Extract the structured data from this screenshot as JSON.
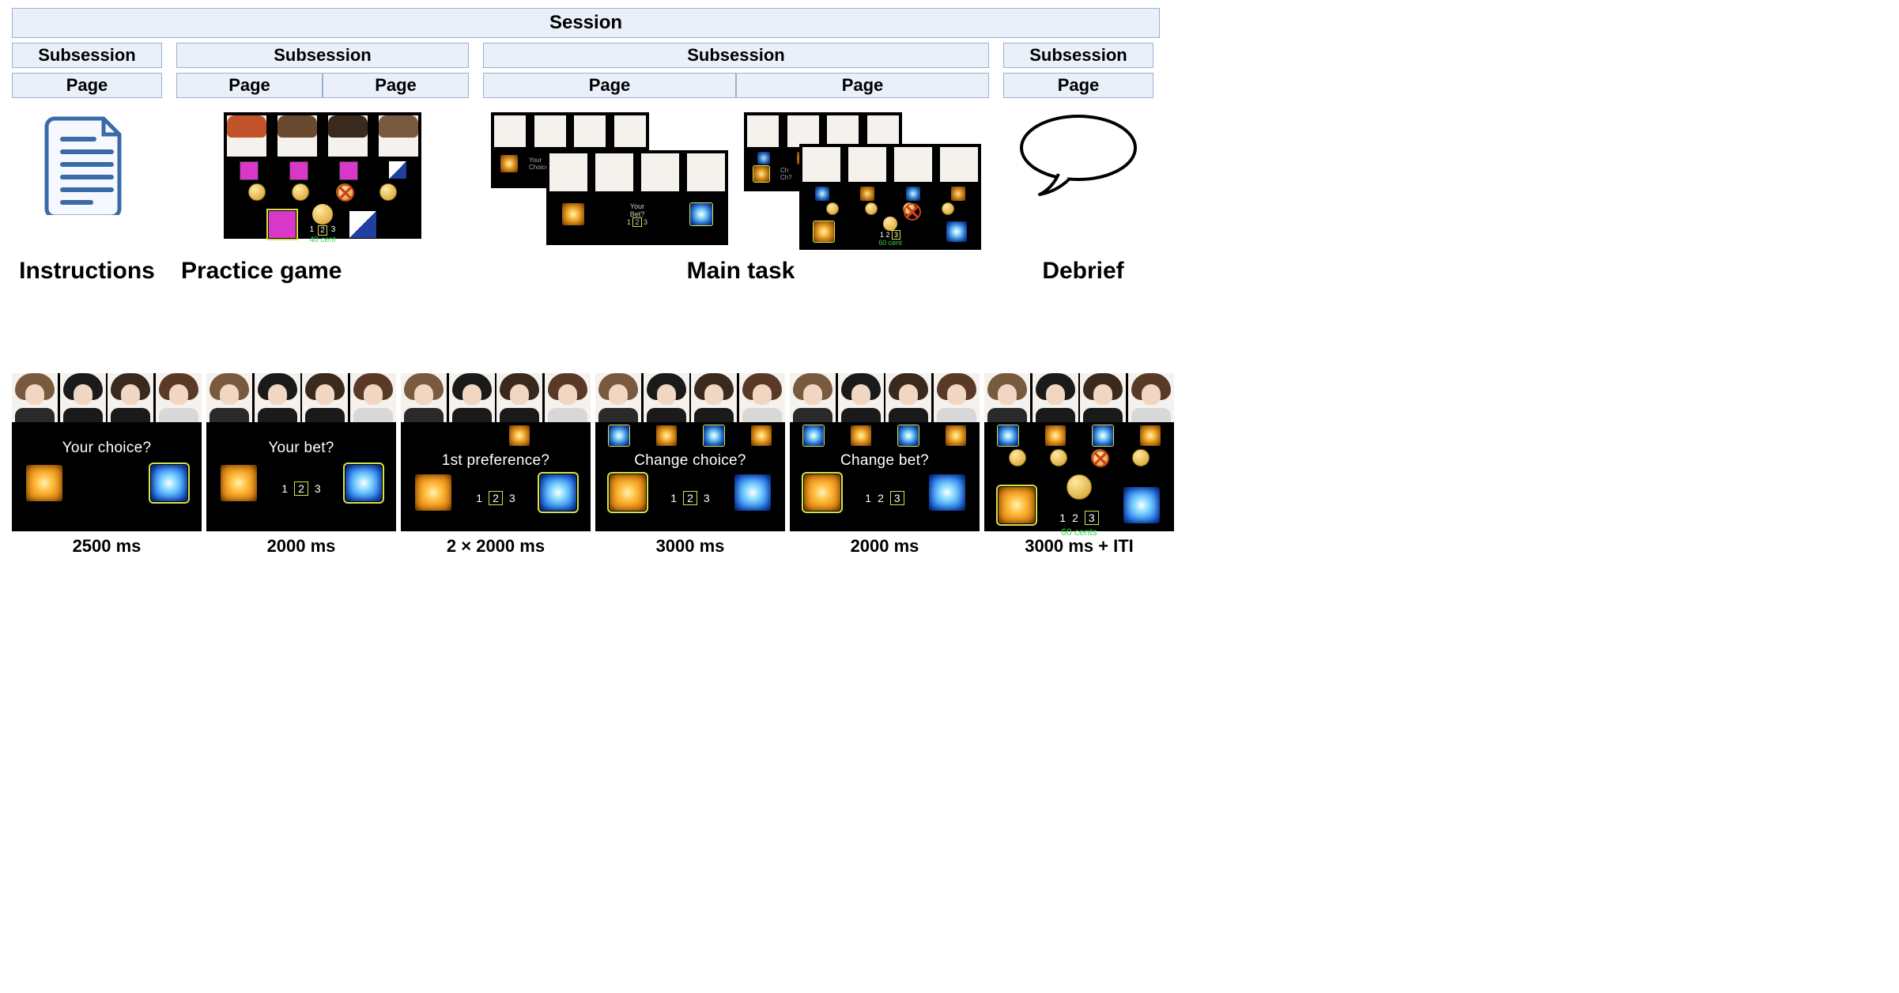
{
  "session_label": "Session",
  "subsession_label": "Subsession",
  "page_label": "Page",
  "top_labels": {
    "instructions": "Instructions",
    "practice": "Practice game",
    "main": "Main task",
    "debrief": "Debrief"
  },
  "widths": {
    "col1": 190,
    "col2": 370,
    "col3": 640,
    "col4": 190,
    "col2_page": 185,
    "col3_page": 320
  },
  "practice_screen": {
    "bet_numbers": [
      "1",
      "2",
      "3"
    ],
    "bet_selected_index": 1,
    "cents_text": "40 cent"
  },
  "main_mini_a": {
    "prompt": "Your\nChoice?"
  },
  "main_mini_b": {
    "prompt": "Ch\nCh?",
    "cents_text": "60 cent"
  },
  "panels": [
    {
      "prompt": "Your choice?",
      "caption": "2500 ms",
      "left_selected": false,
      "right_selected": true,
      "show_bets": false,
      "bet_numbers": [],
      "bet_selected_index": null,
      "show_minis": false,
      "minis": [],
      "show_coins": false,
      "coin_x_index": null,
      "show_bigcoin": false,
      "cents_text": null
    },
    {
      "prompt": "Your bet?",
      "caption": "2000 ms",
      "left_selected": false,
      "right_selected": true,
      "show_bets": true,
      "bet_numbers": [
        "1",
        "2",
        "3"
      ],
      "bet_selected_index": 1,
      "show_minis": false,
      "minis": [],
      "show_coins": false,
      "coin_x_index": null,
      "show_bigcoin": false,
      "cents_text": null
    },
    {
      "prompt": "1st preference?",
      "caption": "2 × 2000 ms",
      "left_selected": false,
      "right_selected": true,
      "show_bets": true,
      "bet_numbers": [
        "1",
        "2",
        "3"
      ],
      "bet_selected_index": 1,
      "show_minis": true,
      "minis": [
        "none",
        "none",
        "orange",
        "none"
      ],
      "show_coins": false,
      "coin_x_index": null,
      "show_bigcoin": false,
      "cents_text": null
    },
    {
      "prompt": "Change choice?",
      "caption": "3000 ms",
      "left_selected": true,
      "right_selected": false,
      "show_bets": true,
      "bet_numbers": [
        "1",
        "2",
        "3"
      ],
      "bet_selected_index": 1,
      "show_minis": true,
      "minis": [
        "blue",
        "orange",
        "blue",
        "orange"
      ],
      "show_coins": false,
      "coin_x_index": null,
      "show_bigcoin": false,
      "cents_text": null
    },
    {
      "prompt": "Change bet?",
      "caption": "2000 ms",
      "left_selected": true,
      "right_selected": false,
      "show_bets": true,
      "bet_numbers": [
        "1",
        "2",
        "3"
      ],
      "bet_selected_index": 2,
      "show_minis": true,
      "minis": [
        "blue",
        "orange",
        "blue",
        "orange"
      ],
      "show_coins": false,
      "coin_x_index": null,
      "show_bigcoin": false,
      "cents_text": null
    },
    {
      "prompt": "",
      "caption": "3000 ms + ITI",
      "left_selected": true,
      "right_selected": false,
      "show_bets": true,
      "bet_numbers": [
        "1",
        "2",
        "3"
      ],
      "bet_selected_index": 2,
      "show_minis": true,
      "minis": [
        "blue",
        "orange",
        "blue",
        "orange"
      ],
      "show_coins": true,
      "coin_x_index": 2,
      "show_bigcoin": true,
      "cents_text": "60 cents"
    }
  ],
  "face_styles": [
    {
      "hair": "#7a5a3e",
      "top": "#2a2a2a"
    },
    {
      "hair": "#1a1a1a",
      "top": "#1a1a1a"
    },
    {
      "hair": "#3a2a1e",
      "top": "#1a1a1a"
    },
    {
      "hair": "#5a3a26",
      "top": "#d8d8d8"
    }
  ]
}
